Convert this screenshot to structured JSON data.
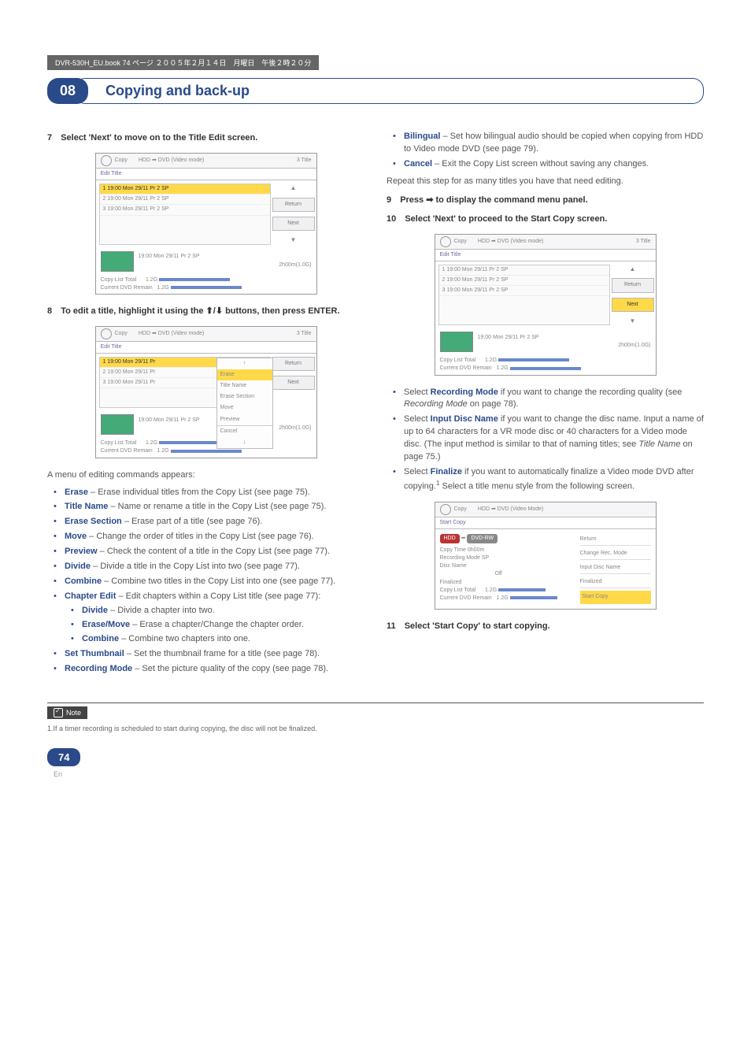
{
  "header_bar": "DVR-530H_EU.book 74 ページ ２００５年２月１４日　月曜日　午後２時２０分",
  "chapter": {
    "num": "08",
    "title": "Copying and back-up"
  },
  "left": {
    "step7": {
      "num": "7",
      "text": "Select 'Next' to move on to the Title Edit screen."
    },
    "scr1": {
      "head_copy": "Copy",
      "head_mode": "HDD ➡ DVD (Video mode)",
      "head_right": "3  Title",
      "tab": "Edit Title",
      "rows": [
        "1   19:00  Mon   29/11  Pr 2    SP",
        "2   19:00  Mon   29/11  Pr 2    SP",
        "3   19:00  Mon   29/11  Pr 2    SP"
      ],
      "btn_return": "Return",
      "btn_next": "Next",
      "preview_line": "19:00  Mon  29/11    Pr 2    SP",
      "preview_time": "2h00m(1.0G)",
      "total1": "Copy List Total",
      "total2": "Current DVD Remain",
      "val1": "1.2G",
      "val2": "1.2G"
    },
    "step8": {
      "num": "8",
      "text_a": "To edit a title, highlight it using the ",
      "text_b": " buttons, then press ENTER."
    },
    "scr2": {
      "popup": [
        "Erase",
        "Title Name",
        "Erase Section",
        "Move",
        "Preview",
        "Cancel"
      ]
    },
    "menu_intro": "A menu of editing commands appears:",
    "bullets": [
      {
        "b": "Erase",
        "t": " – Erase individual titles from the Copy List (see page 75)."
      },
      {
        "b": "Title Name",
        "t": " – Name or rename a title in the Copy List (see page 75)."
      },
      {
        "b": "Erase Section",
        "t": " – Erase part of a title (see page 76)."
      },
      {
        "b": "Move",
        "t": " – Change the order of titles in the Copy List (see page 76)."
      },
      {
        "b": "Preview",
        "t": " – Check the content of a title in the Copy List (see page 77)."
      },
      {
        "b": "Divide",
        "t": " – Divide a title in the Copy List into two (see page 77)."
      },
      {
        "b": "Combine",
        "t": " – Combine two titles in the Copy List into one (see page 77)."
      },
      {
        "b": "Chapter Edit",
        "t": " – Edit chapters within a Copy List title (see page 77):"
      },
      {
        "b": "Set Thumbnail",
        "t": " – Set the thumbnail frame for a title (see page 78)."
      },
      {
        "b": "Recording Mode",
        "t": " – Set the picture quality of the copy (see page 78)."
      }
    ],
    "chapter_sub": [
      {
        "b": "Divide",
        "t": " – Divide a chapter into two."
      },
      {
        "b": "Erase/Move",
        "t": " – Erase a chapter/Change the chapter order."
      },
      {
        "b": "Combine",
        "t": " – Combine two chapters into one."
      }
    ]
  },
  "right": {
    "top_bullets": [
      {
        "b": "Bilingual",
        "t": " – Set how bilingual audio should be copied when copying from HDD to Video mode DVD (see page 79)."
      },
      {
        "b": "Cancel",
        "t": " – Exit the Copy List screen without saving any changes."
      }
    ],
    "repeat": "Repeat this step for as many titles you have that need editing.",
    "step9": {
      "num": "9",
      "text_a": "Press ",
      "text_b": " to display the command menu panel."
    },
    "step10": {
      "num": "10",
      "text": "Select 'Next' to proceed to the Start Copy screen."
    },
    "after_bullets": [
      {
        "b": "Recording Mode",
        "pre": "Select ",
        "t": " if you want to change the recording quality (see ",
        "i": "Recording Mode",
        "t2": " on page 78)."
      },
      {
        "b": "Input Disc Name",
        "pre": "Select ",
        "t": " if you want to change the disc name. Input a name of up to 64 characters for a VR mode disc or 40 characters for a Video mode disc. (The input method is similar to that of naming titles; see ",
        "i": "Title Name",
        "t2": " on page 75.)"
      },
      {
        "b": "Finalize",
        "pre": "Select ",
        "t": " if you want to automatically finalize a Video mode DVD after copying.",
        "sup": "1",
        "t2": " Select a title menu style from the following screen."
      }
    ],
    "scr3": {
      "head_copy": "Copy",
      "head_mode": "HDD ➡ DVD (Video Mode)",
      "tab": "Start Copy",
      "hdd": "HDD",
      "dvd": "DVD-RW",
      "copy_time": "Copy Time     0h00m",
      "rec_mode": "Recording Mode         SP",
      "disc_name": "Disc Name",
      "off": "Off",
      "finalized": "Finalized",
      "total1": "Copy List Total",
      "total2": "Current DVD Remain",
      "val1": "1.2G",
      "val2": "1.2G",
      "side": [
        "Return",
        "Change Rec. Mode",
        "Input Disc Name",
        "Finalized",
        "Start Copy"
      ]
    },
    "step11": {
      "num": "11",
      "text": "Select 'Start Copy' to start copying."
    }
  },
  "note": {
    "label": "Note",
    "text": "1.If a timer recording is scheduled to start during copying, the disc will not be finalized."
  },
  "page": {
    "num": "74",
    "lang": "En"
  }
}
